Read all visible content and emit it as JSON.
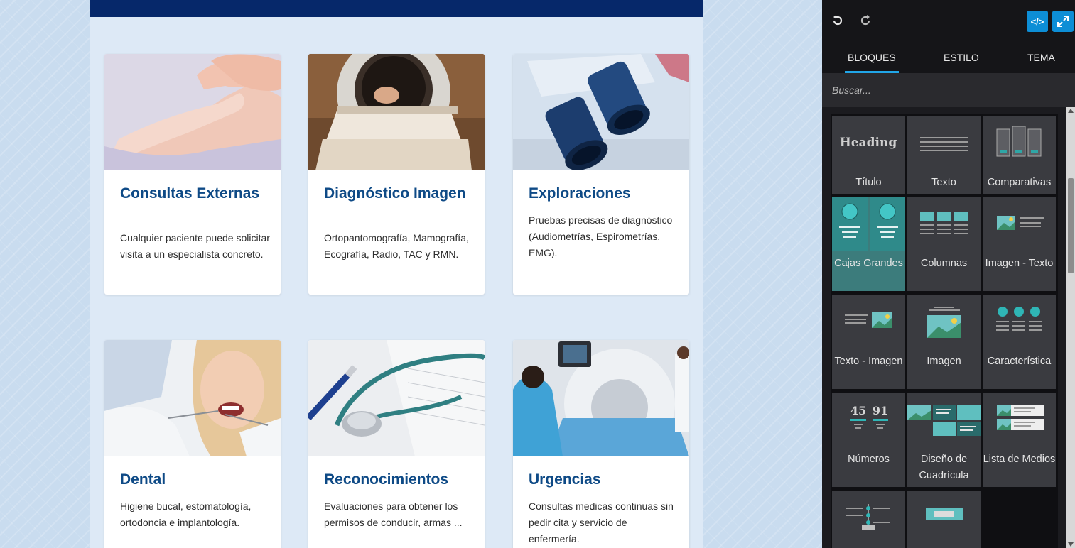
{
  "site": {
    "cards": [
      {
        "title": "Consultas Externas",
        "text": "Cualquier paciente puede solicitar visita a un especialista concreto.",
        "image": "foot-massage-photo"
      },
      {
        "title": "Diagnóstico Imagen",
        "text": "Ortopantomografía, Mamografía, Ecografía, Radio, TAC y RMN.",
        "image": "mri-scanner-photo"
      },
      {
        "title": "Exploraciones",
        "text": "Pruebas precisas de diagnóstico (Audiometrías, Espirometrías, EMG).",
        "image": "microscope-photo"
      },
      {
        "title": "Dental",
        "text": "Higiene bucal, estomatología, ortodoncia e implantología.",
        "image": "dental-exam-photo"
      },
      {
        "title": "Reconocimientos",
        "text": "Evaluaciones para obtener los permisos de conducir, armas ...",
        "image": "stethoscope-photo"
      },
      {
        "title": "Urgencias",
        "text": "Consultas medicas continuas sin pedir cita y servicio de enfermería.",
        "image": "ct-scanner-photo"
      }
    ]
  },
  "editor": {
    "toolbar": {
      "undo_icon": "undo-icon",
      "redo_icon": "redo-icon",
      "code_label": "</>",
      "code_icon": "code-icon",
      "fullscreen_icon": "expand-icon"
    },
    "tabs": [
      "BLOQUES",
      "ESTILO",
      "TEMA"
    ],
    "active_tab": "BLOQUES",
    "search": {
      "placeholder": "Buscar..."
    },
    "blocks": [
      {
        "label": "Título",
        "preview_text": "Heading"
      },
      {
        "label": "Texto"
      },
      {
        "label": "Comparativas"
      },
      {
        "label": "Cajas Grandes",
        "selected": true
      },
      {
        "label": "Columnas"
      },
      {
        "label": "Imagen - Texto"
      },
      {
        "label": "Texto - Imagen"
      },
      {
        "label": "Imagen"
      },
      {
        "label": "Característica"
      },
      {
        "label": "Números",
        "preview_numbers": [
          "45",
          "91"
        ]
      },
      {
        "label": "Diseño de Cuadrícula"
      },
      {
        "label": "Lista de Medios"
      },
      {
        "label": ""
      },
      {
        "label": ""
      }
    ],
    "colors": {
      "accent": "#0d8ed6",
      "tab_underline": "#21a6e8",
      "selected_block": "#3c7c7c",
      "title_blue": "#0e4a86",
      "header_navy": "#06286a"
    }
  }
}
